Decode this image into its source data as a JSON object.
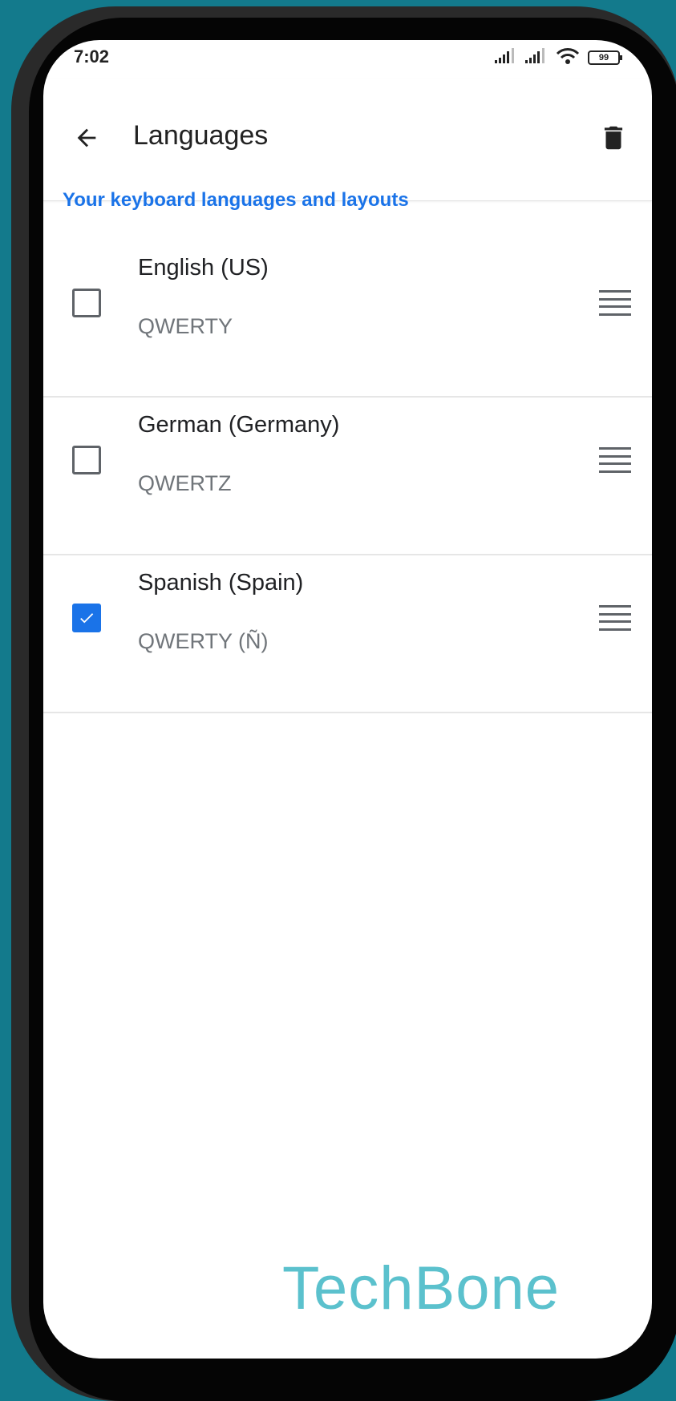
{
  "status_bar": {
    "time": "7:02",
    "battery": "99",
    "icons": [
      "signal-icon",
      "signal-icon",
      "wifi-icon",
      "battery-icon"
    ]
  },
  "app_bar": {
    "title": "Languages",
    "back_icon": "back-arrow-icon",
    "delete_icon": "trash-icon"
  },
  "section": {
    "header": "Your keyboard languages and layouts"
  },
  "languages": [
    {
      "name": "English (US)",
      "layout": "QWERTY",
      "checked": false
    },
    {
      "name": "German (Germany)",
      "layout": "QWERTZ",
      "checked": false
    },
    {
      "name": "Spanish (Spain)",
      "layout": "QWERTY (Ñ)",
      "checked": true
    }
  ],
  "watermark": "TechBone",
  "colors": {
    "accent": "#1a73e8",
    "background": "#137a8c",
    "watermark": "#5bc1cd"
  }
}
